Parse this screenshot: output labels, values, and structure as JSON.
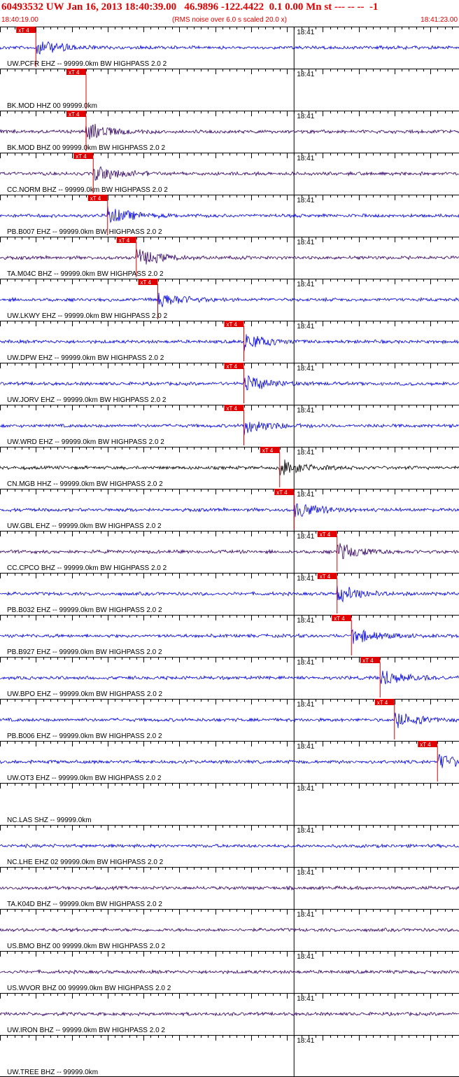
{
  "header": {
    "title": "60493532 UW Jan 16, 2013 18:40:39.00   46.9896 -122.4422  0.1 0.00 Mn st --- -- --  -1",
    "time_start": "18:40:19.00",
    "rms_note": "(RMS noise over 6.0 s scaled 20.0 x)",
    "time_end": "18:41:23.00"
  },
  "minute_label": "18:41",
  "pick_label": "xT 4",
  "colors": {
    "header_text": "#e00000",
    "pick": "#e00000",
    "blue_trace": "#0000dd",
    "purple_trace": "#330066",
    "black_trace": "#000000",
    "panel_line": "#000000"
  },
  "chart_data": {
    "type": "line",
    "title": "60493532 UW Jan 16, 2013 18:40:39.00   46.9896 -122.4422  0.1 0.00 Mn st --- -- --  -1",
    "x_range": [
      "18:40:19.00",
      "18:41:23.00"
    ],
    "minute_marker": "18:41",
    "series": [
      {
        "name": "UW.PCFR EHZ -- 99999.0km BW  HIGHPASS  2.0  2",
        "color": "blue",
        "pick_time_s": 5,
        "has_trace": true
      },
      {
        "name": "BK.MOD HHZ 00 99999.0km",
        "color": "blue",
        "pick_time_s": 12,
        "has_trace": false
      },
      {
        "name": "BK.MOD BHZ 00 99999.0km BW  HIGHPASS  2.0  2",
        "color": "purple",
        "pick_time_s": 12,
        "has_trace": true
      },
      {
        "name": "CC.NORM BHZ -- 99999.0km BW  HIGHPASS  2.0  2",
        "color": "purple",
        "pick_time_s": 13,
        "has_trace": true
      },
      {
        "name": "PB.B007 EHZ -- 99999.0km BW  HIGHPASS  2.0  2",
        "color": "blue",
        "pick_time_s": 15,
        "has_trace": true
      },
      {
        "name": "TA.M04C BHZ -- 99999.0km BW  HIGHPASS  2.0  2",
        "color": "purple",
        "pick_time_s": 19,
        "has_trace": true
      },
      {
        "name": "UW.LKWY EHZ -- 99999.0km BW  HIGHPASS  2.0  2",
        "color": "blue",
        "pick_time_s": 22,
        "has_trace": true
      },
      {
        "name": "UW.DPW EHZ -- 99999.0km BW  HIGHPASS  2.0  2",
        "color": "blue",
        "pick_time_s": 34,
        "has_trace": true
      },
      {
        "name": "UW.JORV EHZ -- 99999.0km BW  HIGHPASS  2.0  2",
        "color": "blue",
        "pick_time_s": 34,
        "has_trace": true
      },
      {
        "name": "UW.WRD EHZ -- 99999.0km BW  HIGHPASS  2.0  2",
        "color": "blue",
        "pick_time_s": 34,
        "has_trace": true
      },
      {
        "name": "CN.MGB HHZ -- 99999.0km BW  HIGHPASS  2.0  2",
        "color": "black",
        "pick_time_s": 39,
        "has_trace": true
      },
      {
        "name": "UW.GBL EHZ -- 99999.0km BW  HIGHPASS  2.0  2",
        "color": "blue",
        "pick_time_s": 41,
        "has_trace": true
      },
      {
        "name": "CC.CPCO BHZ -- 99999.0km BW  HIGHPASS  2.0  2",
        "color": "purple",
        "pick_time_s": 47,
        "has_trace": true
      },
      {
        "name": "PB.B032 EHZ -- 99999.0km BW  HIGHPASS  2.0  2",
        "color": "blue",
        "pick_time_s": 47,
        "has_trace": true
      },
      {
        "name": "PB.B927 EHZ -- 99999.0km BW  HIGHPASS  2.0  2",
        "color": "blue",
        "pick_time_s": 49,
        "has_trace": true
      },
      {
        "name": "UW.BPO EHZ -- 99999.0km BW  HIGHPASS  2.0  2",
        "color": "blue",
        "pick_time_s": 53,
        "has_trace": true
      },
      {
        "name": "PB.B006 EHZ -- 99999.0km BW  HIGHPASS  2.0  2",
        "color": "blue",
        "pick_time_s": 55,
        "has_trace": true
      },
      {
        "name": "UW.OT3 EHZ -- 99999.0km BW  HIGHPASS  2.0  2",
        "color": "blue",
        "pick_time_s": 61,
        "has_trace": true
      },
      {
        "name": "NC.LAS SHZ -- 99999.0km",
        "color": "blue",
        "pick_time_s": null,
        "has_trace": false
      },
      {
        "name": "NC.LHE EHZ 02 99999.0km BW  HIGHPASS  2.0  2",
        "color": "blue",
        "pick_time_s": null,
        "has_trace": true
      },
      {
        "name": "TA.K04D BHZ -- 99999.0km BW  HIGHPASS  2.0  2",
        "color": "purple",
        "pick_time_s": null,
        "has_trace": true
      },
      {
        "name": "US.BMO BHZ 00 99999.0km BW  HIGHPASS  2.0  2",
        "color": "purple",
        "pick_time_s": null,
        "has_trace": true
      },
      {
        "name": "US.WVOR BHZ 00 99999.0km BW  HIGHPASS  2.0  2",
        "color": "purple",
        "pick_time_s": null,
        "has_trace": true
      },
      {
        "name": "UW.IRON BHZ -- 99999.0km BW  HIGHPASS  2.0  2",
        "color": "purple",
        "pick_time_s": null,
        "has_trace": true
      },
      {
        "name": "UW.TREE BHZ -- 99999.0km",
        "color": "blue",
        "pick_time_s": null,
        "has_trace": false
      }
    ]
  }
}
